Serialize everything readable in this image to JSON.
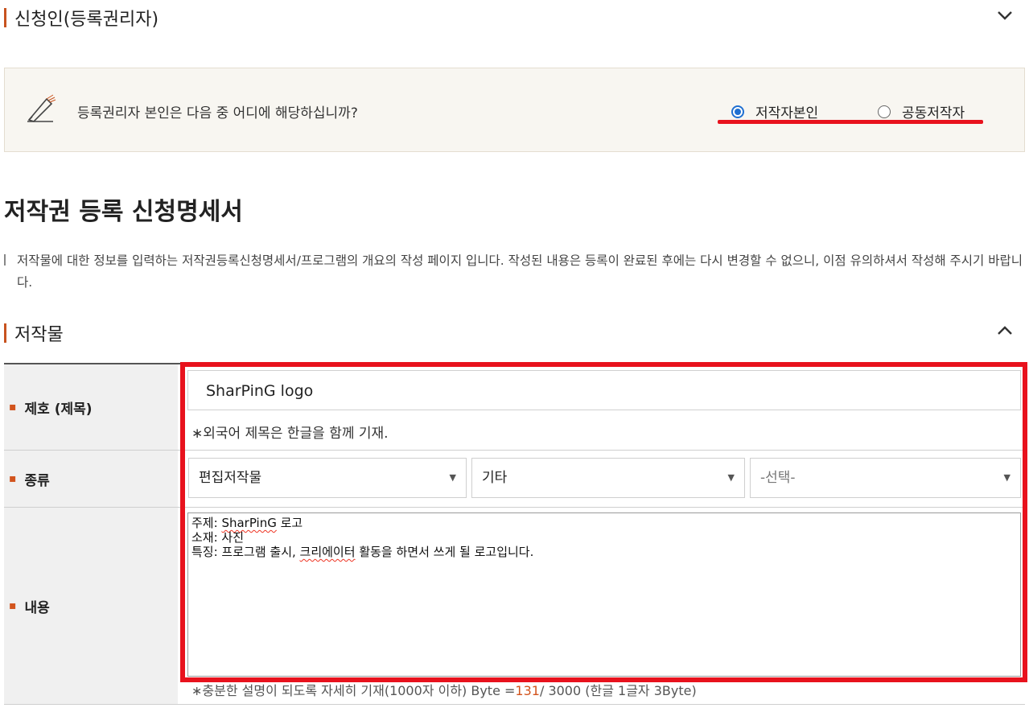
{
  "applicant_section": {
    "title": "신청인(등록권리자)",
    "question": "등록권리자 본인은 다음 중 어디에 해당하십니까?",
    "options": [
      {
        "label": "저작자본인",
        "checked": true
      },
      {
        "label": "공동저작자",
        "checked": false
      }
    ]
  },
  "main_title": "저작권 등록 신청명세서",
  "description": "저작물에 대한 정보를 입력하는 저작권등록신청명세서/프로그램의 개요의 작성 페이지 입니다. 작성된 내용은 등록이 완료된 후에는 다시 변경할 수 없으니, 이점 유의하셔서 작성해 주시기 바랍니다.",
  "work_section": {
    "title": "저작물",
    "rows": {
      "title_label": "제호 (제목)",
      "type_label": "종류",
      "content_label": "내용"
    },
    "title_value": "SharPinG logo",
    "title_hint": "∗외국어 제목은 한글을 함께 기재.",
    "selects": [
      "편집저작물",
      "기타",
      "-선택-"
    ],
    "content_lines": {
      "line1_prefix": "주제: ",
      "line1_word": "SharPinG",
      "line1_suffix": " 로고",
      "line2": "소재: 사진",
      "line3_prefix": "특징: 프로그램 출시, ",
      "line3_word": "크리에이터",
      "line3_suffix": " 활동을 하면서 쓰게 될 로고입니다."
    },
    "byte_hint_prefix": "∗충분한 설명이 되도록 자세히 기재(1000자 이하) Byte =",
    "byte_count": "131",
    "byte_hint_suffix": "/ 3000 (한글 1글자 3Byte)"
  },
  "colors": {
    "accent": "#c8531f",
    "highlight": "#e8121d",
    "radio": "#1f6fd1"
  }
}
